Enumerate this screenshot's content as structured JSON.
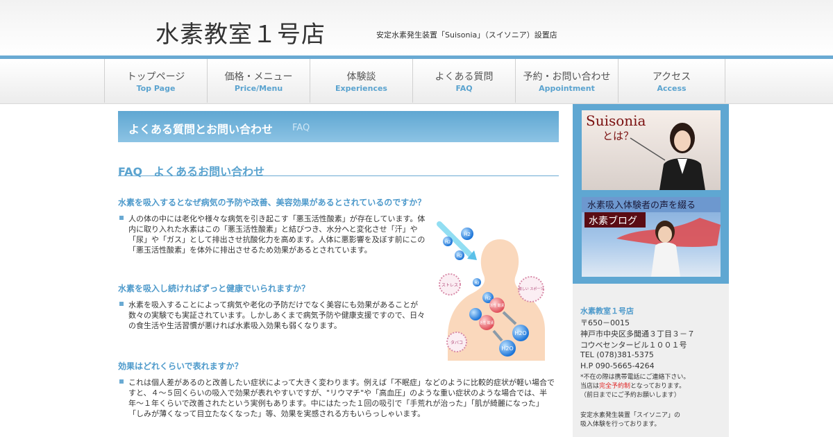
{
  "header": {
    "title": "水素教室１号店",
    "description": "安定水素発生装置「Suisonia」（スイソニア）設置店"
  },
  "nav": [
    {
      "jp": "トップページ",
      "en": "Top Page"
    },
    {
      "jp": "価格・メニュー",
      "en": "Price/Menu"
    },
    {
      "jp": "体験談",
      "en": "Experiences"
    },
    {
      "jp": "よくある質問",
      "en": "FAQ"
    },
    {
      "jp": "予約・お問い合わせ",
      "en": "Appointment"
    },
    {
      "jp": "アクセス",
      "en": "Access"
    }
  ],
  "page": {
    "title": "よくある質問とお問い合わせ",
    "subtitle": "FAQ",
    "heading": "FAQ　よくあるお問い合わせ"
  },
  "faq": [
    {
      "question": "水素を吸入するとなぜ病気の予防や改善、美容効果があるとされているのですか？",
      "answer_lines": [
        "人の体の中には老化や様々な病気を引き起こす「悪玉活性酸素」が存在しています。体",
        "内に取り入れた水素はこの「悪玉活性酸素」と結びつき、水分へと変化させ「汗」や",
        "「尿」や「ガス」として排出させ抗酸化力を高めます。人体に悪影響を及ぼす前にこの",
        "「悪玉活性酸素」を体外に排出させるため効果があるとされています。"
      ]
    },
    {
      "question": "水素を吸入し続ければずっと健康でいられますか？",
      "answer_lines": [
        "水素を吸入することによって病気や老化の予防だけでなく美容にも効果があることが",
        "数々の実験でも実証されています。しかしあくまで病気予防や健康支援ですので、日々",
        "の食生活や生活習慣が悪ければ水素吸入効果も弱くなります。"
      ]
    },
    {
      "question": "効果はどれくらいで表れますか？",
      "answer_lines": [
        "これは個人差があるのと改善したい症状によって大きく変わります。例えば「不眠症」などのように比較的症状が軽い場合で",
        "すと、４～５回くらいの吸入で効果が表れやすいですが、\"リウマチ\"や「高血圧」のような重い症状のような場合では、半",
        "年～１年くらいで改善されたという実例もあります。中にはたった１回の吸引で「手荒れが治った」「肌が綺麗になった」",
        "「しみが薄くなって目立たなくなった」等、効果を実感される方もいらっしゃいます。"
      ]
    }
  ],
  "illustration": {
    "labels": [
      "H2",
      "H2",
      "H2",
      "H2",
      "H2",
      "H2O",
      "H2O",
      "ストレス",
      "激しい スポーツ",
      "タバコ",
      "活性 酸素",
      "活性 酸素"
    ]
  },
  "sidebar": {
    "banner1": {
      "title": "Suisonia",
      "subtitle": "とは？"
    },
    "banner2": {
      "title": "水素吸入体験者の声を綴る",
      "subtitle": "水素ブログ"
    },
    "shop": {
      "name": "水素教室１号店",
      "postal": "〒650－0015",
      "address1": "神戸市中央区多聞通３丁目３－７",
      "address2": "コウベセンタービル１００１号",
      "tel": "TEL (078)381-5375",
      "hp": "H.P 090-5665-4264",
      "note1": "*不在の際は携帯電話にご連絡下さい。",
      "note2_pre": "当店は",
      "note2_red": "完全予約制",
      "note2_post": "となっております。",
      "note3": "（前日までにご予約お願いします）",
      "note4": "安定水素発生装置「スイソニア」の",
      "note5": "吸入体験を行っております。"
    }
  },
  "colors": {
    "accent": "#5aa3cf",
    "banner": "#5fa7d2",
    "red": "#e02020"
  }
}
